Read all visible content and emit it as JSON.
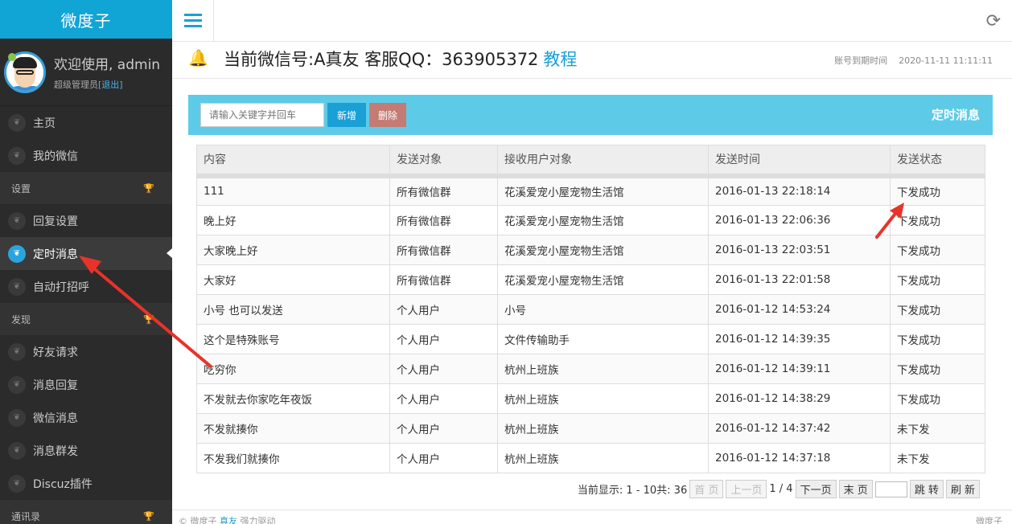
{
  "brand": "微度子",
  "profile": {
    "welcome": "欢迎使用, admin",
    "role": "超级管理员",
    "logout": "[退出]"
  },
  "nav": {
    "home": "主页",
    "my_wechat": "我的微信",
    "group_settings": "设置",
    "reply_settings": "回复设置",
    "scheduled": "定时消息",
    "auto_greet": "自动打招呼",
    "group_discover": "发现",
    "friend_requests": "好友请求",
    "msg_reply": "消息回复",
    "wechat_msgs": "微信消息",
    "broadcast": "消息群发",
    "discuz": "Discuz插件",
    "group_contacts": "通讯录"
  },
  "header": {
    "title": "当前微信号:A真友 客服QQ：363905372",
    "tutorial": "教程",
    "expire_label": "账号到期时间",
    "expire_date": "2020-11-11 11:11:11"
  },
  "panel": {
    "search_placeholder": "请输入关键字并回车",
    "add_label": "新增",
    "delete_label": "删除",
    "title": "定时消息"
  },
  "table": {
    "headers": [
      "内容",
      "发送对象",
      "接收用户对象",
      "发送时间",
      "发送状态"
    ],
    "rows": [
      [
        "111",
        "所有微信群",
        "花溪爱宠小屋宠物生活馆",
        "2016-01-13 22:18:14",
        "下发成功"
      ],
      [
        "晚上好",
        "所有微信群",
        "花溪爱宠小屋宠物生活馆",
        "2016-01-13 22:06:36",
        "下发成功"
      ],
      [
        "大家晚上好",
        "所有微信群",
        "花溪爱宠小屋宠物生活馆",
        "2016-01-13 22:03:51",
        "下发成功"
      ],
      [
        "大家好",
        "所有微信群",
        "花溪爱宠小屋宠物生活馆",
        "2016-01-13 22:01:58",
        "下发成功"
      ],
      [
        "小号 也可以发送",
        "个人用户",
        "小号",
        "2016-01-12 14:53:24",
        "下发成功"
      ],
      [
        "这个是特殊账号",
        "个人用户",
        "文件传输助手",
        "2016-01-12 14:39:35",
        "下发成功"
      ],
      [
        "吃穷你",
        "个人用户",
        "杭州上班族",
        "2016-01-12 14:39:11",
        "下发成功"
      ],
      [
        "不发就去你家吃年夜饭",
        "个人用户",
        "杭州上班族",
        "2016-01-12 14:38:29",
        "下发成功"
      ],
      [
        "不发就揍你",
        "个人用户",
        "杭州上班族",
        "2016-01-12 14:37:42",
        "未下发"
      ],
      [
        "不发我们就揍你",
        "个人用户",
        "杭州上班族",
        "2016-01-12 14:37:18",
        "未下发"
      ]
    ]
  },
  "pager": {
    "info": "当前显示: 1 - 10共: 36",
    "first": "首 页",
    "prev": "上一页",
    "page": "1 / 4",
    "next": "下一页",
    "last": "末 页",
    "jump": "跳 转",
    "refresh": "刷 新"
  },
  "footer": {
    "left": "© 微度子",
    "link": "真友",
    "suffix": "强力驱动",
    "right": "微度子"
  },
  "colors": {
    "accent": "#1aa0d5",
    "panel_head": "#5dcbe8",
    "sidebar": "#2b2b2b",
    "arrow": "#e8332a"
  }
}
